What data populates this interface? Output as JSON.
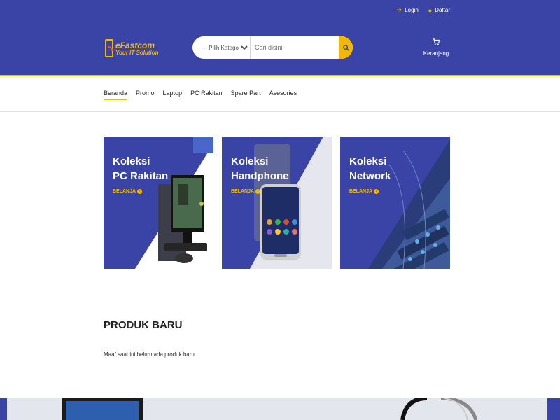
{
  "colors": {
    "primary": "#3a44a6",
    "accent": "#f5b800"
  },
  "header": {
    "links": [
      {
        "label": "Login",
        "icon": "login-icon"
      },
      {
        "label": "Daftar",
        "icon": "user-icon"
      }
    ],
    "logo": {
      "name": "eFastcom",
      "tagline": "Your IT Solution"
    },
    "search": {
      "category_selected": "--- Pilih Kategori ---",
      "placeholder": "Cari disini"
    },
    "cart": {
      "label": "Keranjang",
      "icon": "cart-icon"
    }
  },
  "nav": {
    "tabs": [
      "Beranda",
      "Promo",
      "Laptop",
      "PC Rakitan",
      "Spare Part",
      "Asesories"
    ],
    "active": "Beranda"
  },
  "cards": [
    {
      "line1": "Koleksi",
      "line2": "PC Rakitan",
      "cta": "BELANJA"
    },
    {
      "line1": "Koleksi",
      "line2": "Handphone",
      "cta": "BELANJA"
    },
    {
      "line1": "Koleksi",
      "line2": "Network",
      "cta": "BELANJA"
    }
  ],
  "section": {
    "title": "PRODUK BARU",
    "empty_message": "Maaf saat ini belum ada produk baru"
  }
}
